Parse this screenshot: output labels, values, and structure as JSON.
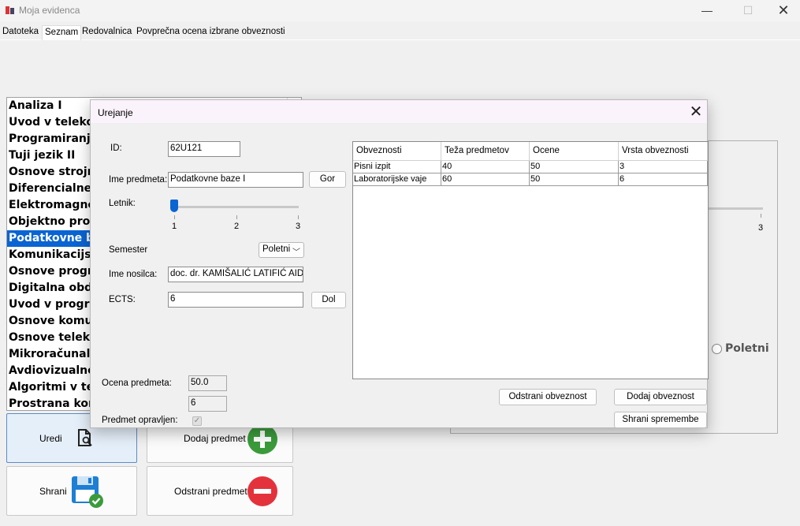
{
  "window": {
    "title": "Moja evidenca"
  },
  "menu": [
    "Datoteka",
    "Seznam",
    "Redovalnica",
    "Povprečna ocena izbrane obveznosti"
  ],
  "subjects": [
    "Analiza I",
    "Uvod v telekomunikacije",
    "Programiranje I",
    "Tuji jezik II",
    "Osnove strojne opreme",
    "Diferencialne enačbe",
    "Elektromagnetno polje",
    "Objektno programiranje",
    "Podatkovne baze I",
    "Komunikacijski sistemi",
    "Osnove programiranja",
    "Digitalna obdelava signalov",
    "Uvod v programiranje",
    "Osnove komunikacij",
    "Osnove telekomunikacij",
    "Mikroračunalniki",
    "Avdiovizualne tehnologije",
    "Algoritmi v telekomunikacijah",
    "Prostrana komunikacija"
  ],
  "selected_subject_index": 8,
  "actions": {
    "edit": "Uredi",
    "add": "Dodaj predmet",
    "save": "Shrani",
    "remove": "Odstrani predmet"
  },
  "background_panel": {
    "slider_tick": "3",
    "radio_label": "Poletni"
  },
  "dialog": {
    "title": "Urejanje",
    "id_label": "ID:",
    "id_value": "62U121",
    "name_label": "Ime predmeta:",
    "name_value": "Podatkovne baze I",
    "up_button": "Gor",
    "year_label": "Letnik:",
    "year_ticks": [
      "1",
      "2",
      "3"
    ],
    "year_value": 1,
    "semester_label": "Semester",
    "semester_value": "Poletni",
    "lecturer_label": "Ime nosilca:",
    "lecturer_value": "doc. dr. KAMIŠALIĆ LATIFIĆ AIDA",
    "ects_label": "ECTS:",
    "ects_value": "6",
    "down_button": "Dol",
    "grade_label": "Ocena predmeta:",
    "grade_value": "50.0",
    "grade_value2": "6",
    "passed_label": "Predmet opravljen:",
    "passed_checked": true,
    "table": {
      "headers": [
        "Obveznosti",
        "Teža predmetov",
        "Ocene",
        "Vrsta obveznosti"
      ],
      "rows": [
        [
          "Pisni izpit",
          "40",
          "50",
          "3"
        ],
        [
          "Laboratorijske vaje",
          "60",
          "50",
          "6"
        ]
      ]
    },
    "remove_obligation": "Odstrani obveznost",
    "add_obligation": "Dodaj obveznost",
    "save_changes": "Shrani spremembe"
  }
}
